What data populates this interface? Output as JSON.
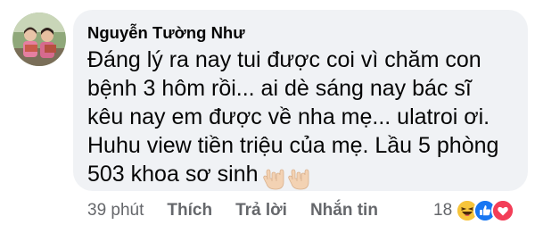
{
  "comment": {
    "author": "Nguyễn Tường Như",
    "text": "Đáng lý ra nay tui được coi vì chăm con bệnh 3 hôm rồi... ai dè sáng nay bác sĩ kêu nay em được về nha mẹ... ulatroi ơi. Huhu view tiền triệu của mẹ. Lầu 5 phòng 503 khoa sơ sinh",
    "emoji_icon": "love-you-gesture-emoji"
  },
  "actions": {
    "time": "39 phút",
    "like": "Thích",
    "reply": "Trả lời",
    "message": "Nhắn tin"
  },
  "reactions": {
    "count": "18",
    "icons": [
      "haha-icon",
      "like-icon",
      "love-icon"
    ],
    "colors": {
      "haha": "#f7b125",
      "like": "#1877f2",
      "love": "#f33e58"
    }
  },
  "colors": {
    "bubble": "#f0f2f5",
    "text": "#050505",
    "secondary": "#65676b"
  }
}
